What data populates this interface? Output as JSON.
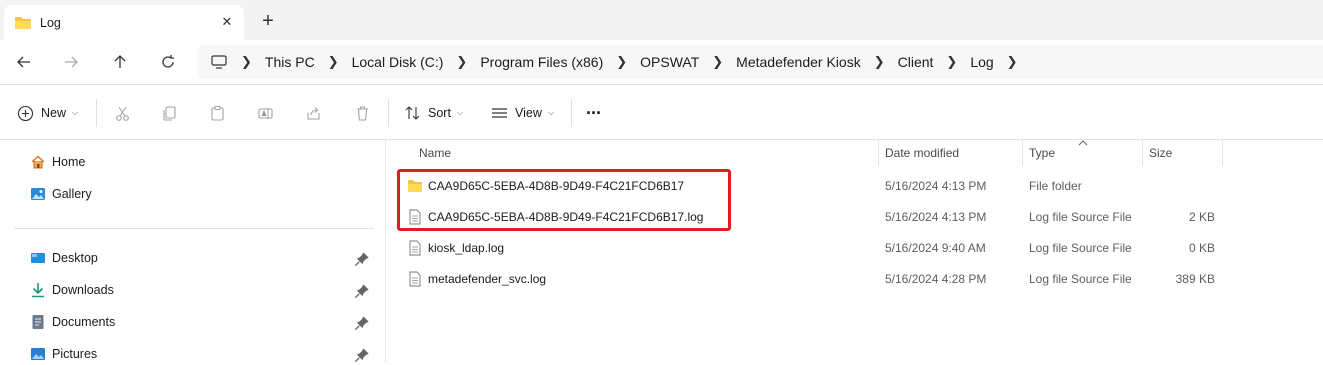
{
  "window": {
    "tab_title": "Log",
    "tab_close_glyph": "✕",
    "new_tab_glyph": "+"
  },
  "breadcrumb": [
    "This PC",
    "Local Disk (C:)",
    "Program Files (x86)",
    "OPSWAT",
    "Metadefender Kiosk",
    "Client",
    "Log"
  ],
  "command_bar": {
    "new_label": "New",
    "sort_label": "Sort",
    "view_label": "View",
    "more_glyph": "···"
  },
  "nav": {
    "items": [
      {
        "label": "Home",
        "icon": "home-icon"
      },
      {
        "label": "Gallery",
        "icon": "gallery-icon"
      },
      {
        "label": "Desktop",
        "icon": "desktop-icon",
        "pinned": true
      },
      {
        "label": "Downloads",
        "icon": "downloads-icon",
        "pinned": true
      },
      {
        "label": "Documents",
        "icon": "documents-icon",
        "pinned": true
      },
      {
        "label": "Pictures",
        "icon": "pictures-icon",
        "pinned": true
      }
    ]
  },
  "columns": {
    "name": "Name",
    "date": "Date modified",
    "type": "Type",
    "size": "Size"
  },
  "files": [
    {
      "name": "CAA9D65C-5EBA-4D8B-9D49-F4C21FCD6B17",
      "date": "5/16/2024 4:13 PM",
      "type": "File folder",
      "size": "",
      "icon": "folder-icon"
    },
    {
      "name": "CAA9D65C-5EBA-4D8B-9D49-F4C21FCD6B17.log",
      "date": "5/16/2024 4:13 PM",
      "type": "Log file Source File",
      "size": "2 KB",
      "icon": "file-icon"
    },
    {
      "name": "kiosk_ldap.log",
      "date": "5/16/2024 9:40 AM",
      "type": "Log file Source File",
      "size": "0 KB",
      "icon": "file-icon"
    },
    {
      "name": "metadefender_svc.log",
      "date": "5/16/2024 4:28 PM",
      "type": "Log file Source File",
      "size": "389 KB",
      "icon": "file-icon"
    }
  ],
  "colors": {
    "folder": "#f4c542",
    "highlight_border": "#e01e1e",
    "accent": "#0067c0"
  }
}
